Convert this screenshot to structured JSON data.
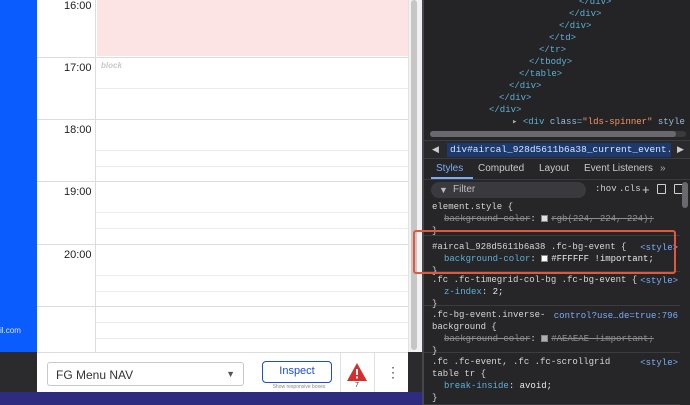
{
  "sidebar": {
    "email_fragment": "il.com"
  },
  "calendar": {
    "hours": [
      "16:00",
      "17:00",
      "18:00",
      "19:00",
      "20:00"
    ],
    "event_label": "block"
  },
  "toolbar": {
    "menu_selected": "FG Menu NAV",
    "inspect_label": "Inspect",
    "responsive_label": "Show responsive boxes",
    "warning_count": "7"
  },
  "devtools": {
    "dom_lines": [
      {
        "indent": 155,
        "text": "</div>"
      },
      {
        "indent": 145,
        "text": "</div>"
      },
      {
        "indent": 135,
        "text": "</div>"
      },
      {
        "indent": 125,
        "text": "</td>"
      },
      {
        "indent": 115,
        "text": "</tr>"
      },
      {
        "indent": 105,
        "text": "</tbody>"
      },
      {
        "indent": 95,
        "text": "</table>"
      },
      {
        "indent": 85,
        "text": "</div>"
      },
      {
        "indent": 75,
        "text": "</div>"
      },
      {
        "indent": 65,
        "text": "</div>"
      }
    ],
    "spinner_line": {
      "caret": "▸",
      "tag_open": "<div ",
      "attr": "class",
      "eq": "=",
      "value": "\"lds-spinner\"",
      "trail": " style"
    },
    "breadcrumb_id": "div#aircal_928d5611b6a38_current_event",
    "breadcrumb_class": ".fc-even",
    "tabs": [
      "Styles",
      "Computed",
      "Layout",
      "Event Listeners",
      "»"
    ],
    "filter_placeholder": "Filter",
    "hov": ":hov",
    "cls": ".cls",
    "rules": [
      {
        "selector": "element.style {",
        "source": "",
        "props": [
          {
            "name": "background-color",
            "value": "rgb(224, 224, 224);",
            "swatch": "#e0e0e0",
            "struck": true
          }
        ]
      },
      {
        "selector": "#aircal_928d5611b6a38 .fc-bg-event {",
        "source": "<style>",
        "props": [
          {
            "name": "background-color",
            "value": "#FFFFFF !important;",
            "swatch": "#ffffff",
            "struck": false
          }
        ]
      },
      {
        "selector": ".fc .fc-timegrid-col-bg .fc-bg-event {",
        "source": "<style>",
        "props": [
          {
            "name": "z-index",
            "value": "2;",
            "swatch": "",
            "struck": false
          }
        ]
      },
      {
        "selector": ".fc-bg-event.inverse-",
        "selector2": "background {",
        "source": "control?use…de=true:796",
        "props": [
          {
            "name": "background-color",
            "value": "#AEAEAE !important;",
            "swatch": "#aeaeae",
            "struck": true
          }
        ]
      },
      {
        "selector": ".fc .fc-event, .fc .fc-scrollgrid",
        "selector2": "table tr {",
        "source": "<style>",
        "props": [
          {
            "name": "break-inside",
            "value": "avoid;",
            "swatch": "",
            "struck": false
          }
        ]
      }
    ],
    "close_brace": "}",
    "colon": ":"
  },
  "colors": {
    "accent": "#0b5cff",
    "highlight": "#e2583e",
    "devtools_link": "#7cacf8"
  }
}
